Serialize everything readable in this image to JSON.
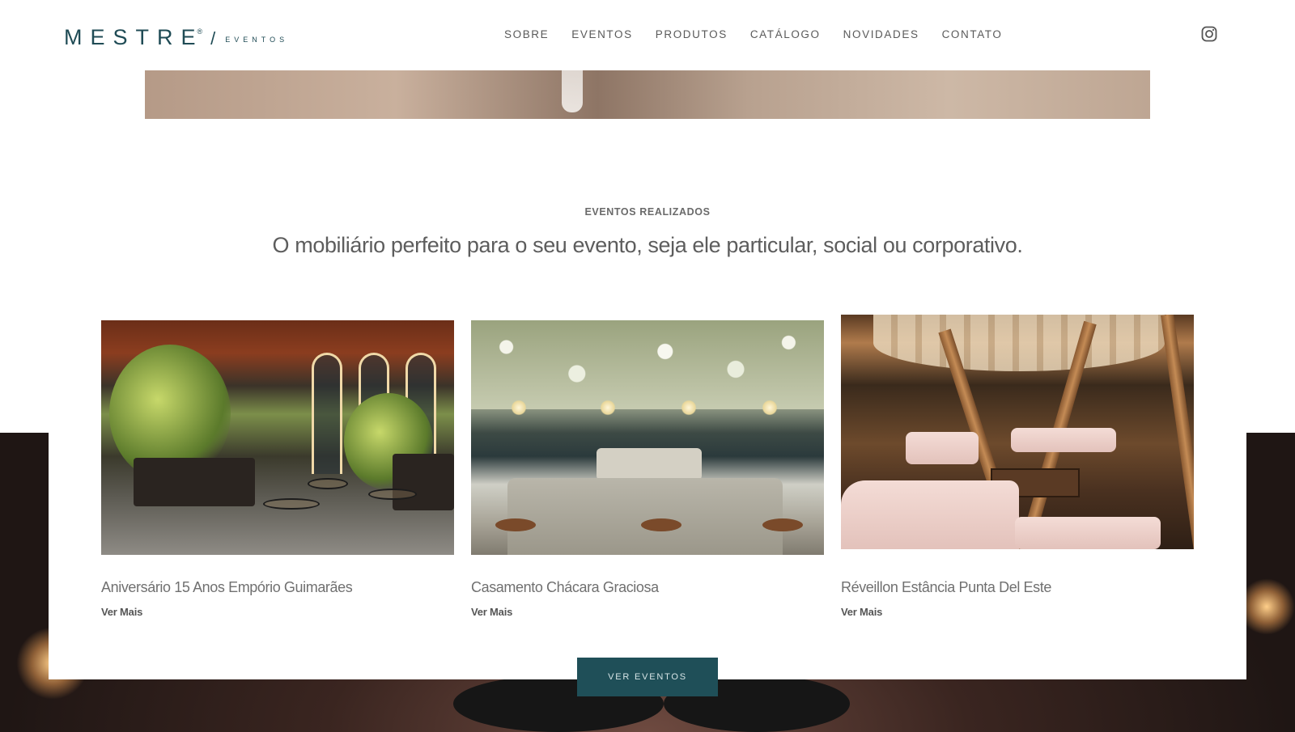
{
  "header": {
    "logo": {
      "main": "MESTRE",
      "registered": "®",
      "slash": "/",
      "sub": "EVENTOS"
    },
    "nav": [
      "SOBRE",
      "EVENTOS",
      "PRODUTOS",
      "CATÁLOGO",
      "NOVIDADES",
      "CONTATO"
    ],
    "social_icon": "instagram-icon"
  },
  "section": {
    "eyebrow": "EVENTOS REALIZADOS",
    "headline": "O mobiliário perfeito para o seu evento, seja ele particular, social ou corporativo."
  },
  "events": [
    {
      "title": "Aniversário 15 Anos Empório Guimarães",
      "link": "Ver Mais"
    },
    {
      "title": "Casamento Chácara Graciosa",
      "link": "Ver Mais"
    },
    {
      "title": "Réveillon Estância Punta Del Este",
      "link": "Ver Mais"
    }
  ],
  "cta": {
    "label": "VER EVENTOS"
  },
  "colors": {
    "brand": "#1f4b55",
    "button": "#1f4f58"
  }
}
